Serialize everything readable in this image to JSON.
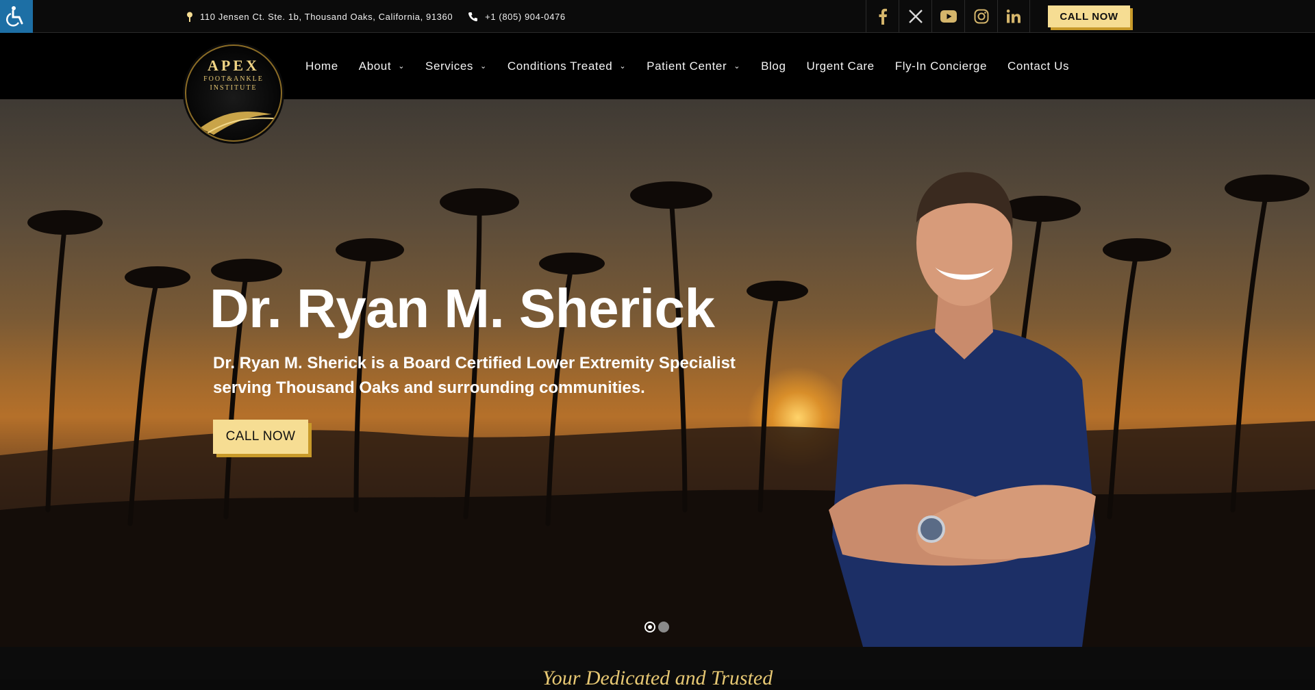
{
  "topbar": {
    "address": "110 Jensen Ct. Ste. 1b, Thousand Oaks, California, 91360",
    "phone": "+1 (805) 904-0476",
    "cta_label": "CALL NOW",
    "social": [
      "facebook-icon",
      "x-icon",
      "youtube-icon",
      "instagram-icon",
      "linkedin-icon"
    ]
  },
  "logo": {
    "title": "APEX",
    "line1": "FOOT&ANKLE",
    "line2": "INSTITUTE"
  },
  "nav": {
    "items": [
      {
        "label": "Home",
        "dropdown": false
      },
      {
        "label": "About",
        "dropdown": true
      },
      {
        "label": "Services",
        "dropdown": true
      },
      {
        "label": "Conditions Treated",
        "dropdown": true
      },
      {
        "label": "Patient Center",
        "dropdown": true
      },
      {
        "label": "Blog",
        "dropdown": false
      },
      {
        "label": "Urgent Care",
        "dropdown": false
      },
      {
        "label": "Fly-In Concierge",
        "dropdown": false
      },
      {
        "label": "Contact Us",
        "dropdown": false
      }
    ]
  },
  "hero": {
    "title": "Dr. Ryan M. Sherick",
    "subtitle_line1": "Dr. Ryan M. Sherick is a Board Certified Lower Extremity Specialist",
    "subtitle_line2": "serving Thousand Oaks and surrounding communities.",
    "cta_label": "CALL NOW",
    "slides_total": 2,
    "slide_active": 1
  },
  "below": {
    "tagline": "Your Dedicated and Trusted"
  },
  "colors": {
    "accent": "#f6dd93",
    "accent_shadow": "#c89a2a",
    "a11y_bg": "#1d6fa5",
    "nav_bg": "#000000",
    "gold_text": "#e7c873"
  }
}
